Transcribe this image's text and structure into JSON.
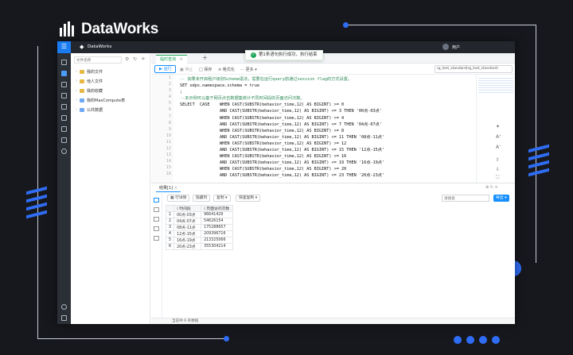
{
  "brand": {
    "name": "DataWorks"
  },
  "topbar": {
    "product": "DataWorks",
    "user": "用户"
  },
  "toast": {
    "message": "第1条语句执行成功，执行结束"
  },
  "tree": {
    "search_placeholder": "文件名称",
    "items": [
      {
        "label": "我的文件"
      },
      {
        "label": "他人文件"
      },
      {
        "label": "我的收藏"
      },
      {
        "label": "我的MaxCompute表"
      },
      {
        "label": "公共数据"
      }
    ]
  },
  "tabs": {
    "active": "临时查询",
    "add": "+"
  },
  "toolbar": {
    "run": "运行",
    "stop": "停止",
    "save": "保存",
    "format": "格式化",
    "more": "更多",
    "project": "rg_test_standard(rg_test_standard)"
  },
  "editor": {
    "line_numbers": [
      "1",
      "2",
      "3",
      "4",
      "5",
      "6",
      "7",
      "8",
      "9",
      "10",
      "11",
      "12",
      "13",
      "14",
      "15",
      "16"
    ],
    "run_hint": "运行",
    "lines": [
      {
        "t": "-- 如果未开启租户级别Schema语法，需要在运行query前通过session flag的方式设置。",
        "c": "cmt"
      },
      {
        "t": "SET odps.namespace.schema = true",
        "c": ""
      },
      {
        "t": ";",
        "c": ""
      },
      {
        "t": "--本示例可以基于网页点击数据集统计不同时间段的页面访问次数。",
        "c": "cmt"
      },
      {
        "t": "SELECT  CASE    WHEN CAST(SUBSTR(behavior_time,12) AS BIGINT) >= 0",
        "c": ""
      },
      {
        "t": "                AND CAST(SUBSTR(behavior_time,12) AS BIGINT) <= 3 THEN '00点-03点'",
        "c": ""
      },
      {
        "t": "                WHEN CAST(SUBSTR(behavior_time,12) AS BIGINT) >= 4",
        "c": ""
      },
      {
        "t": "                AND CAST(SUBSTR(behavior_time,12) AS BIGINT) <= 7 THEN '04点-07点'",
        "c": ""
      },
      {
        "t": "                WHEN CAST(SUBSTR(behavior_time,12) AS BIGINT) >= 8",
        "c": ""
      },
      {
        "t": "                AND CAST(SUBSTR(behavior_time,12) AS BIGINT) <= 11 THEN '08点-11点'",
        "c": ""
      },
      {
        "t": "                WHEN CAST(SUBSTR(behavior_time,12) AS BIGINT) >= 12",
        "c": ""
      },
      {
        "t": "                AND CAST(SUBSTR(behavior_time,12) AS BIGINT) <= 15 THEN '12点-15点'",
        "c": ""
      },
      {
        "t": "                WHEN CAST(SUBSTR(behavior_time,12) AS BIGINT) >= 16",
        "c": ""
      },
      {
        "t": "                AND CAST(SUBSTR(behavior_time,12) AS BIGINT) <= 19 THEN '16点-19点'",
        "c": ""
      },
      {
        "t": "                WHEN CAST(SUBSTR(behavior_time,12) AS BIGINT) >= 20",
        "c": ""
      },
      {
        "t": "                AND CAST(SUBSTR(behavior_time,12) AS BIGINT) <= 23 THEN '20点-23点'",
        "c": ""
      }
    ]
  },
  "results": {
    "tab": "结果[1]",
    "toolbar": {
      "row_detail": "行详情",
      "hide_column": "隐藏列",
      "copy": "复制",
      "quick_copy": "快速复制",
      "search_placeholder": "请搜索",
      "export": "导出"
    },
    "columns": [
      "时间段",
      "页面访问次数"
    ],
    "rows": [
      {
        "n": "1",
        "period": "00点-03点",
        "count": "96641429"
      },
      {
        "n": "2",
        "period": "04点-07点",
        "count": "54626154"
      },
      {
        "n": "3",
        "period": "08点-11点",
        "count": "175288657"
      },
      {
        "n": "4",
        "period": "12点-15点",
        "count": "209396716"
      },
      {
        "n": "5",
        "period": "16点-19点",
        "count": "213325066"
      },
      {
        "n": "6",
        "period": "20点-23点",
        "count": "355304214"
      }
    ],
    "status": "当前共 6 条数据"
  },
  "colors": {
    "accent": "#1890ff",
    "brand_blue": "#2f6df6",
    "success": "#22a55a"
  }
}
